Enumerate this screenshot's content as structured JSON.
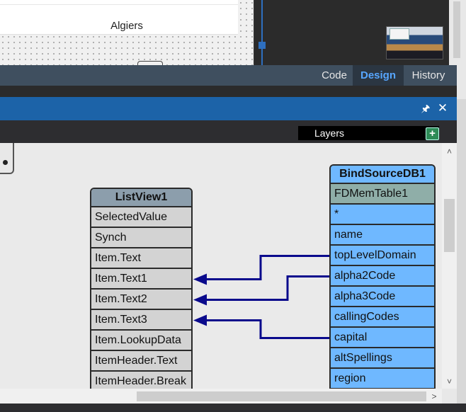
{
  "form_preview": {
    "list_item_text": "Algiers"
  },
  "view_tabs": {
    "code": "Code",
    "design": "Design",
    "history": "History",
    "active": "Design"
  },
  "panel": {
    "pin_icon": "pin-icon",
    "close_icon": "close-icon"
  },
  "layers": {
    "label": "Layers",
    "add_icon": "plus-icon"
  },
  "listview": {
    "title": "ListView1",
    "fields": [
      "SelectedValue",
      "Synch",
      "Item.Text",
      "Item.Text1",
      "Item.Text2",
      "Item.Text3",
      "Item.LookupData",
      "ItemHeader.Text",
      "ItemHeader.Break"
    ]
  },
  "bindsource": {
    "title": "BindSourceDB1",
    "fields": [
      "FDMemTable1",
      "*",
      "name",
      "topLevelDomain",
      "alpha2Code",
      "alpha3Code",
      "callingCodes",
      "capital",
      "altSpellings",
      "region"
    ]
  },
  "links": [
    {
      "from": "topLevelDomain",
      "to": "Item.Text1"
    },
    {
      "from": "alpha2Code",
      "to": "Item.Text2"
    },
    {
      "from": "capital",
      "to": "Item.Text3"
    }
  ],
  "colors": {
    "accent": "#1c63a8",
    "link": "#0a0a8c",
    "bindsource_fill": "#6fb8ff",
    "listview_header": "#8c9eac"
  }
}
